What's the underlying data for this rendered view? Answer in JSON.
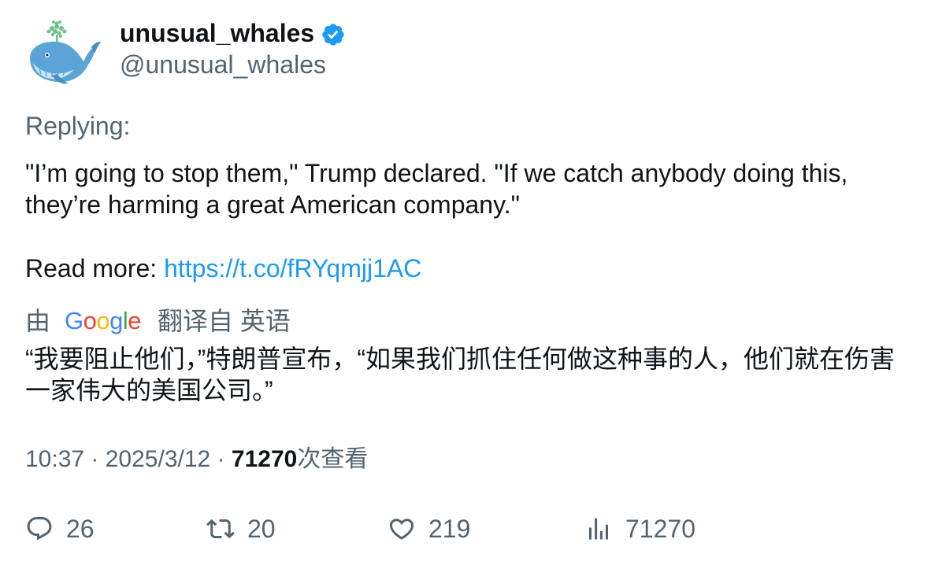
{
  "author": {
    "display_name": "unusual_whales",
    "handle": "@unusual_whales",
    "verified_icon": "verified-badge-icon",
    "avatar_icon": "whale-avatar"
  },
  "replying_label": "Replying:",
  "tweet": {
    "line1": "\"I’m going to stop them,\" Trump declared. \"If we catch anybody doing this,",
    "line2": "they’re harming a great American company.\"",
    "read_more_label": "Read more: ",
    "link": "https://t.co/fRYqmjj1AC"
  },
  "translation": {
    "by_label": "由",
    "provider": "Google",
    "from_label": "翻译自 英语",
    "line1": "“我要阻止他们，”特朗普宣布，“如果我们抓住任何做这种事的人，他们就在伤害",
    "line2": "一家伟大的美国公司。”"
  },
  "meta": {
    "time": "10:37",
    "separator": " · ",
    "date": "2025/3/12",
    "views": "71270",
    "views_label": "次查看"
  },
  "actions": {
    "replies": "26",
    "retweets": "20",
    "likes": "219",
    "views": "71270"
  },
  "colors": {
    "text": "#0f1419",
    "secondary": "#536471",
    "link": "#1d9bf0",
    "verified": "#1d9bf0"
  }
}
